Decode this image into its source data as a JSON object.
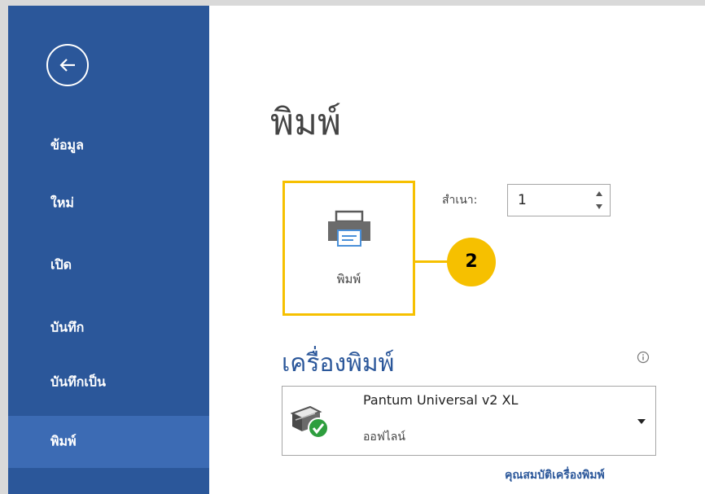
{
  "sidebar": {
    "back_icon": "arrow-left-circle-icon",
    "items": [
      {
        "label": "ข้อมูล"
      },
      {
        "label": "ใหม่"
      },
      {
        "label": "เปิด"
      },
      {
        "label": "บันทึก"
      },
      {
        "label": "บันทึกเป็น"
      },
      {
        "label": "พิมพ์",
        "active": true
      }
    ]
  },
  "main": {
    "title": "พิมพ์",
    "print_button": {
      "label": "พิมพ์",
      "icon": "printer-icon"
    },
    "copies": {
      "label": "สำเนา:",
      "value": "1"
    },
    "callout": {
      "number": "2"
    },
    "printer_section": {
      "heading": "เครื่องพิมพ์",
      "info_icon": "info-icon",
      "selected": {
        "name": "Pantum Universal v2 XL",
        "status": "ออฟไลน์",
        "icon": "printer-ready-icon"
      },
      "properties_link": "คุณสมบัติเครื่องพิมพ์"
    }
  },
  "colors": {
    "sidebar": "#2b579a",
    "sidebar_active": "#3c6bb4",
    "highlight": "#f6c000",
    "status_ok": "#2e9e3e"
  }
}
